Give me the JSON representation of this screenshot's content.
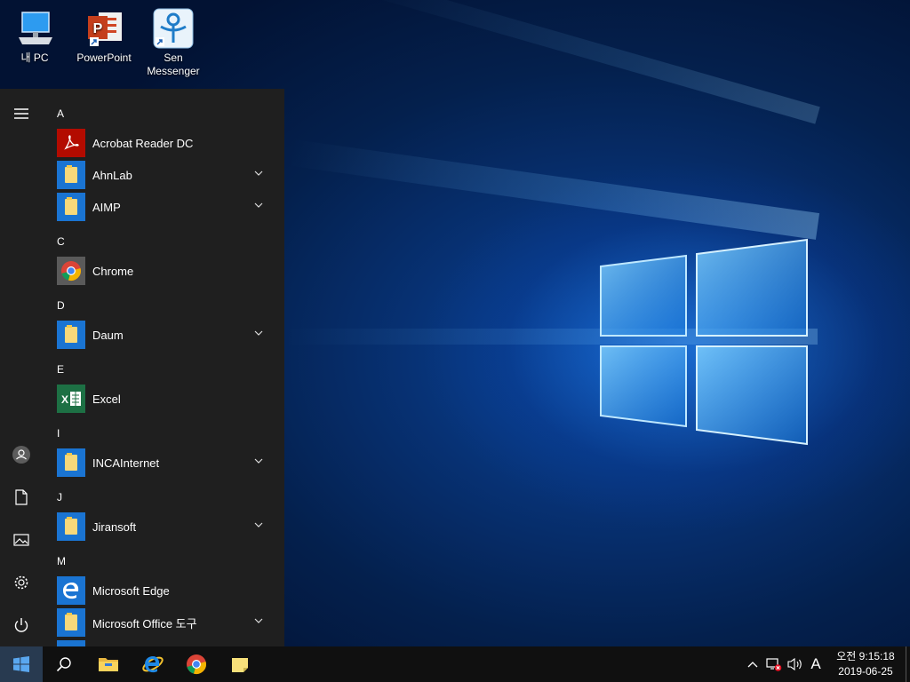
{
  "desktop": {
    "icons": [
      {
        "label": "내 PC",
        "icon": "pc-icon"
      },
      {
        "label": "PowerPoint",
        "icon": "powerpoint-icon"
      },
      {
        "label": "Sen Messenger",
        "icon": "sen-messenger-icon"
      }
    ]
  },
  "start_menu": {
    "rail": [
      "menu-icon",
      "user-icon",
      "documents-icon",
      "pictures-icon",
      "settings-icon",
      "power-icon"
    ],
    "letters": [
      "A",
      "C",
      "D",
      "E",
      "I",
      "J",
      "M"
    ],
    "apps": [
      {
        "label": "Acrobat Reader DC",
        "icon": "acrobat-icon",
        "expandable": false
      },
      {
        "label": "AhnLab",
        "icon": "folder-icon",
        "expandable": true
      },
      {
        "label": "AIMP",
        "icon": "folder-icon",
        "expandable": true
      },
      {
        "label": "Chrome",
        "icon": "chrome-icon",
        "expandable": false
      },
      {
        "label": "Daum",
        "icon": "folder-icon",
        "expandable": true
      },
      {
        "label": "Excel",
        "icon": "excel-icon",
        "expandable": false
      },
      {
        "label": "INCAInternet",
        "icon": "folder-icon",
        "expandable": true
      },
      {
        "label": "Jiransoft",
        "icon": "folder-icon",
        "expandable": true
      },
      {
        "label": "Microsoft Edge",
        "icon": "edge-icon",
        "expandable": false
      },
      {
        "label": "Microsoft Office 도구",
        "icon": "folder-icon",
        "expandable": true
      }
    ]
  },
  "taskbar": {
    "pinned": [
      "start-icon",
      "search-icon",
      "file-explorer-icon",
      "internet-explorer-icon",
      "chrome-icon",
      "sticky-notes-icon"
    ],
    "tray": {
      "input_indicator": "A",
      "time": "오전 9:15:18",
      "date": "2019-06-25"
    }
  },
  "colors": {
    "accent": "#1a74d2",
    "start_bg": "#1f1f1f",
    "taskbar_bg": "#101010"
  }
}
